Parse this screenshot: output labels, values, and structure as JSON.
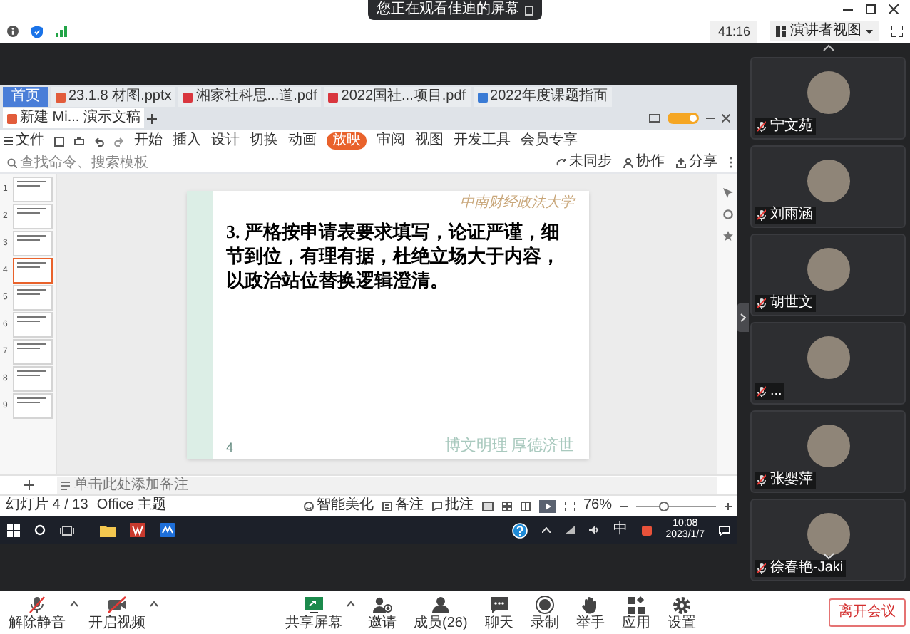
{
  "top_bar": {
    "banner": "您正在观看佳迪的屏幕",
    "timer": "41:16",
    "view_button": "演讲者视图"
  },
  "shared_screen": {
    "tabs": [
      {
        "label": "首页",
        "kind": "home",
        "selected": false
      },
      {
        "label": "23.1.8 材图.pptx",
        "kind": "ppt",
        "selected": false
      },
      {
        "label": "湘家社科思...道.pdf",
        "kind": "pdf",
        "selected": false
      },
      {
        "label": "2022国社...项目.pdf",
        "kind": "pdf",
        "selected": false
      },
      {
        "label": "2022年度课题指面",
        "kind": "doc",
        "selected": false
      },
      {
        "label": "新建 Mi... 演示文稿",
        "kind": "ppt",
        "selected": true
      }
    ],
    "file_menu": "文件",
    "ribbon_tabs": [
      {
        "label": "开始",
        "selected": false
      },
      {
        "label": "插入",
        "selected": false
      },
      {
        "label": "设计",
        "selected": false
      },
      {
        "label": "切换",
        "selected": false
      },
      {
        "label": "动画",
        "selected": false
      },
      {
        "label": "放映",
        "selected": true
      },
      {
        "label": "审阅",
        "selected": false
      },
      {
        "label": "视图",
        "selected": false
      },
      {
        "label": "开发工具",
        "selected": false
      },
      {
        "label": "会员专享",
        "selected": false
      }
    ],
    "search": {
      "placeholder": "查找命令、搜索模板"
    },
    "ribbon_actions": [
      {
        "label": "未同步",
        "kind": "sync"
      },
      {
        "label": "协作",
        "kind": "collab"
      },
      {
        "label": "分享",
        "kind": "share"
      }
    ],
    "thumbnails": [
      {
        "number": "1",
        "selected": false
      },
      {
        "number": "2",
        "selected": false
      },
      {
        "number": "3",
        "selected": false
      },
      {
        "number": "4",
        "selected": true
      },
      {
        "number": "5",
        "selected": false
      },
      {
        "number": "6",
        "selected": false
      },
      {
        "number": "7",
        "selected": false
      },
      {
        "number": "8",
        "selected": false
      },
      {
        "number": "9",
        "selected": false
      }
    ],
    "slide": {
      "header": "中南财经政法大学",
      "text": "3. 严格按申请表要求填写，论证严谨，细节到位，有理有据，杜绝立场大于内容，以政治站位替换逻辑澄清。",
      "motto": "博文明理  厚德济世",
      "page": "4"
    },
    "notes_placeholder": "单击此处添加备注",
    "status_bar": {
      "slide_count": "幻灯片 4 / 13",
      "theme": "Office 主题",
      "beautify": "智能美化",
      "notes": "备注",
      "comments": "批注",
      "zoom": "76%",
      "zoom_slider": {
        "level": 0.35
      }
    },
    "taskbar": {
      "ime": "中",
      "time": "10:08",
      "date": "2023/1/7"
    }
  },
  "participants": [
    {
      "name": "宁文苑"
    },
    {
      "name": "刘雨涵"
    },
    {
      "name": "胡世文"
    },
    {
      "name": "..."
    },
    {
      "name": "张婴萍"
    },
    {
      "name": "徐春艳-Jaki"
    }
  ],
  "left_controls": [
    {
      "label": "解除静音",
      "kind": "mic",
      "menu": true
    },
    {
      "label": "开启视频",
      "kind": "camera",
      "menu": true
    }
  ],
  "center_controls": [
    {
      "label": "共享屏幕",
      "kind": "share",
      "menu": true
    },
    {
      "label": "邀请",
      "kind": "invite",
      "menu": false
    },
    {
      "label": "成员(26)",
      "kind": "members",
      "menu": false
    },
    {
      "label": "聊天",
      "kind": "chat",
      "menu": false
    },
    {
      "label": "录制",
      "kind": "record",
      "menu": false
    },
    {
      "label": "举手",
      "kind": "hand",
      "menu": false
    },
    {
      "label": "应用",
      "kind": "apps",
      "menu": false
    },
    {
      "label": "设置",
      "kind": "settings",
      "menu": false
    }
  ],
  "leave_button": "离开会议"
}
